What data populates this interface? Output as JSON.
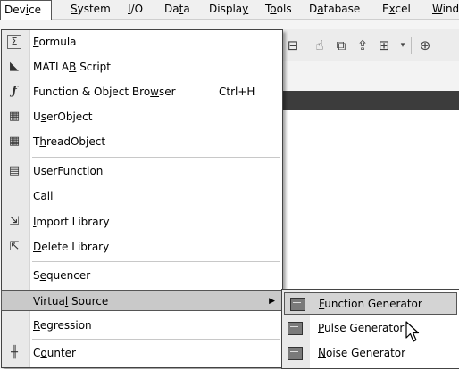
{
  "menubar": {
    "items": [
      {
        "pre": "Dev",
        "u": "i",
        "post": "ce"
      },
      {
        "pre": "",
        "u": "S",
        "post": "ystem"
      },
      {
        "pre": "",
        "u": "I",
        "post": "/O"
      },
      {
        "pre": "Da",
        "u": "t",
        "post": "a"
      },
      {
        "pre": "Displa",
        "u": "y",
        "post": ""
      },
      {
        "pre": "T",
        "u": "o",
        "post": "ols"
      },
      {
        "pre": "D",
        "u": "a",
        "post": "tabase"
      },
      {
        "pre": "E",
        "u": "x",
        "post": "cel"
      },
      {
        "pre": "",
        "u": "W",
        "post": "ind"
      }
    ]
  },
  "device_menu": {
    "items": [
      {
        "pre": "",
        "u": "F",
        "post": "ormula",
        "icon": "sigma-icon",
        "glyph": "Σ"
      },
      {
        "pre": "MATLA",
        "u": "B",
        "post": " Script",
        "icon": "matlab-icon",
        "glyph": "◣"
      },
      {
        "pre": "Function & Object Bro",
        "u": "w",
        "post": "ser",
        "shortcut": "Ctrl+H",
        "icon": "function-icon",
        "glyph": "ƒ"
      },
      {
        "pre": "U",
        "u": "s",
        "post": "erObject",
        "icon": "userobject-icon",
        "glyph": "▦"
      },
      {
        "pre": "T",
        "u": "h",
        "post": "readObject",
        "icon": "threadobject-icon",
        "glyph": "▦"
      },
      {
        "pre": "",
        "u": "U",
        "post": "serFunction",
        "icon": "userfunction-icon",
        "glyph": "▤"
      },
      {
        "pre": "",
        "u": "C",
        "post": "all"
      },
      {
        "pre": "",
        "u": "I",
        "post": "mport Library",
        "icon": "import-library-icon",
        "glyph": "⇲"
      },
      {
        "pre": "",
        "u": "D",
        "post": "elete Library",
        "icon": "delete-library-icon",
        "glyph": "⇱"
      },
      {
        "pre": "S",
        "u": "e",
        "post": "quencer"
      },
      {
        "pre": "Virtua",
        "u": "l",
        "post": " Source"
      },
      {
        "pre": "",
        "u": "R",
        "post": "egression"
      },
      {
        "pre": "C",
        "u": "o",
        "post": "unter",
        "icon": "counter-icon",
        "glyph": "╫"
      }
    ]
  },
  "virtual_source_submenu": {
    "items": [
      {
        "pre": "",
        "u": "F",
        "post": "unction Generator"
      },
      {
        "pre": "",
        "u": "P",
        "post": "ulse Generator"
      },
      {
        "pre": "",
        "u": "N",
        "post": "oise Generator"
      }
    ]
  }
}
